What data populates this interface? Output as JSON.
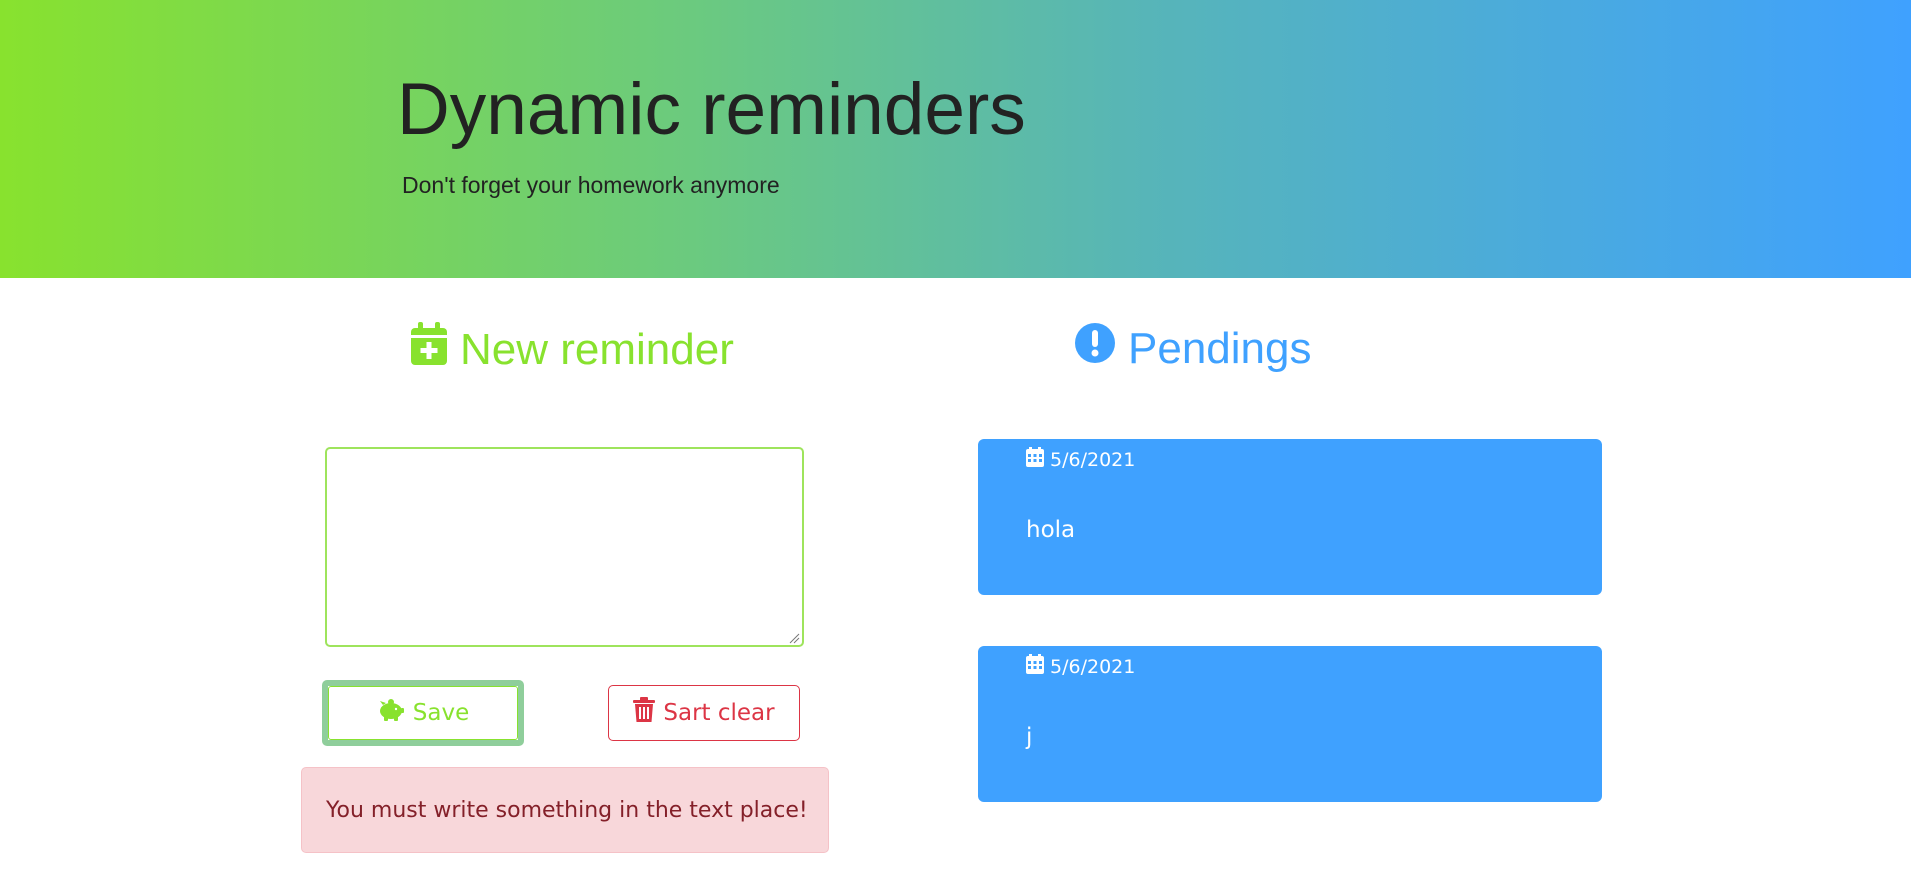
{
  "header": {
    "title": "Dynamic reminders",
    "subtitle": "Don't forget your homework anymore",
    "gradient_start": "#88e22e",
    "gradient_end": "#3fa1ff"
  },
  "new_reminder": {
    "title": "New reminder",
    "icon": "calendar-plus-icon",
    "textarea_value": "",
    "save_label": "Save",
    "save_icon": "piggy-bank-icon",
    "clear_label": "Sart clear",
    "clear_icon": "trash-icon",
    "alert_text": "You must write something in the text place!"
  },
  "pendings": {
    "title": "Pendings",
    "icon": "exclamation-circle-icon",
    "items": [
      {
        "date": "5/6/2021",
        "text": "hola"
      },
      {
        "date": "5/6/2021",
        "text": "j"
      }
    ]
  },
  "colors": {
    "green": "#88e22e",
    "blue": "#3fa1ff",
    "danger": "#dc3545",
    "alert_bg": "#f8d7da"
  }
}
